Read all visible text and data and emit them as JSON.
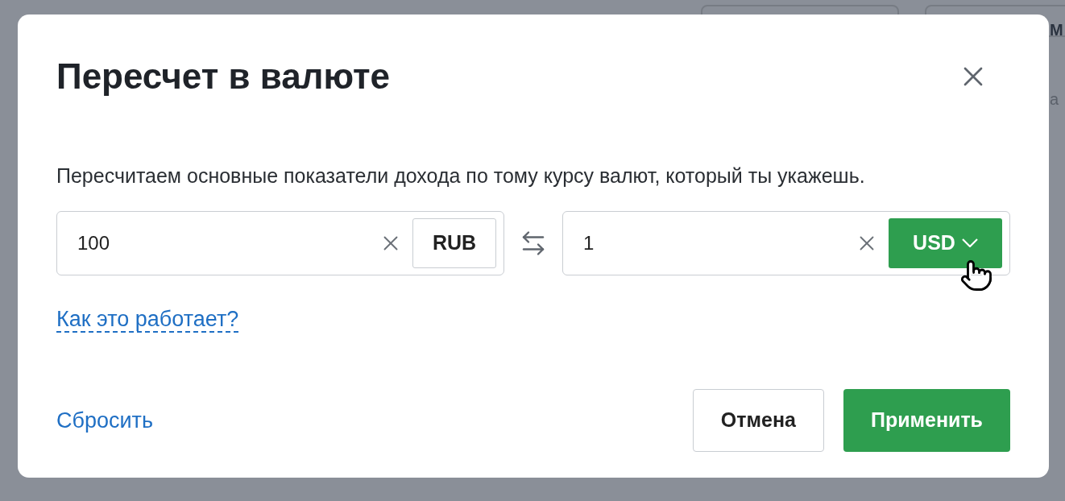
{
  "background": {
    "texts": [
      "М",
      "а"
    ]
  },
  "dialog": {
    "title": "Пересчет в валюте",
    "description": "Пересчитаем основные показатели дохода по тому курсу валют, который ты укажешь.",
    "from": {
      "value": "100",
      "currency": "RUB",
      "kind": "static"
    },
    "to": {
      "value": "1",
      "currency": "USD",
      "kind": "dropdown"
    },
    "help_link": "Как это работает?",
    "reset": "Сбросить",
    "buttons": [
      {
        "label": "Отмена",
        "kind": "secondary"
      },
      {
        "label": "Применить",
        "kind": "primary"
      }
    ]
  }
}
